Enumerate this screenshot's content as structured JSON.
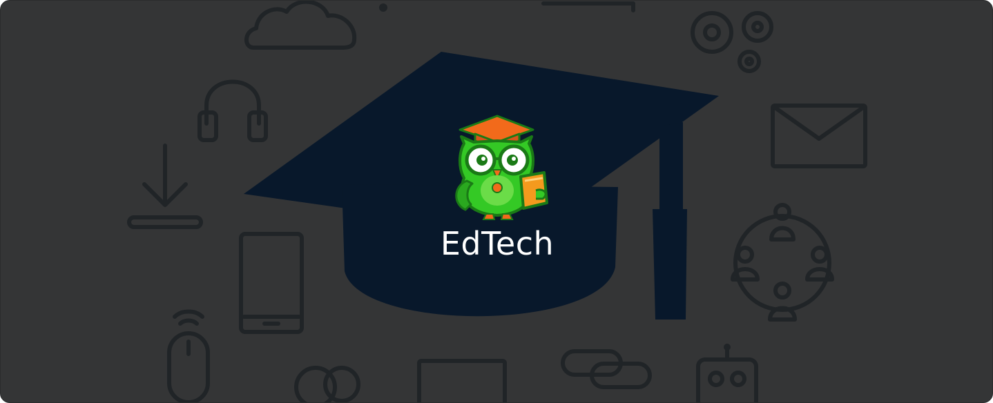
{
  "brand": {
    "name": "EdTech"
  },
  "colors": {
    "background": "#343536",
    "icon_outline": "#202427",
    "graduation_cap": "#08182b",
    "owl_green": "#34c925",
    "owl_dark_green": "#1a7a16",
    "cap_orange": "#f26a1b",
    "tablet_orange": "#f49a1e",
    "text": "#ffffff"
  },
  "decorative_icons": [
    "cloud-icon",
    "gears-icon",
    "headphones-icon",
    "email-icon",
    "download-icon",
    "tablet-device-icon",
    "network-people-icon",
    "wireless-mouse-icon",
    "chat-bubbles-icon",
    "monitor-icon",
    "chain-link-icon",
    "robot-icon",
    "graduation-cap-icon"
  ]
}
